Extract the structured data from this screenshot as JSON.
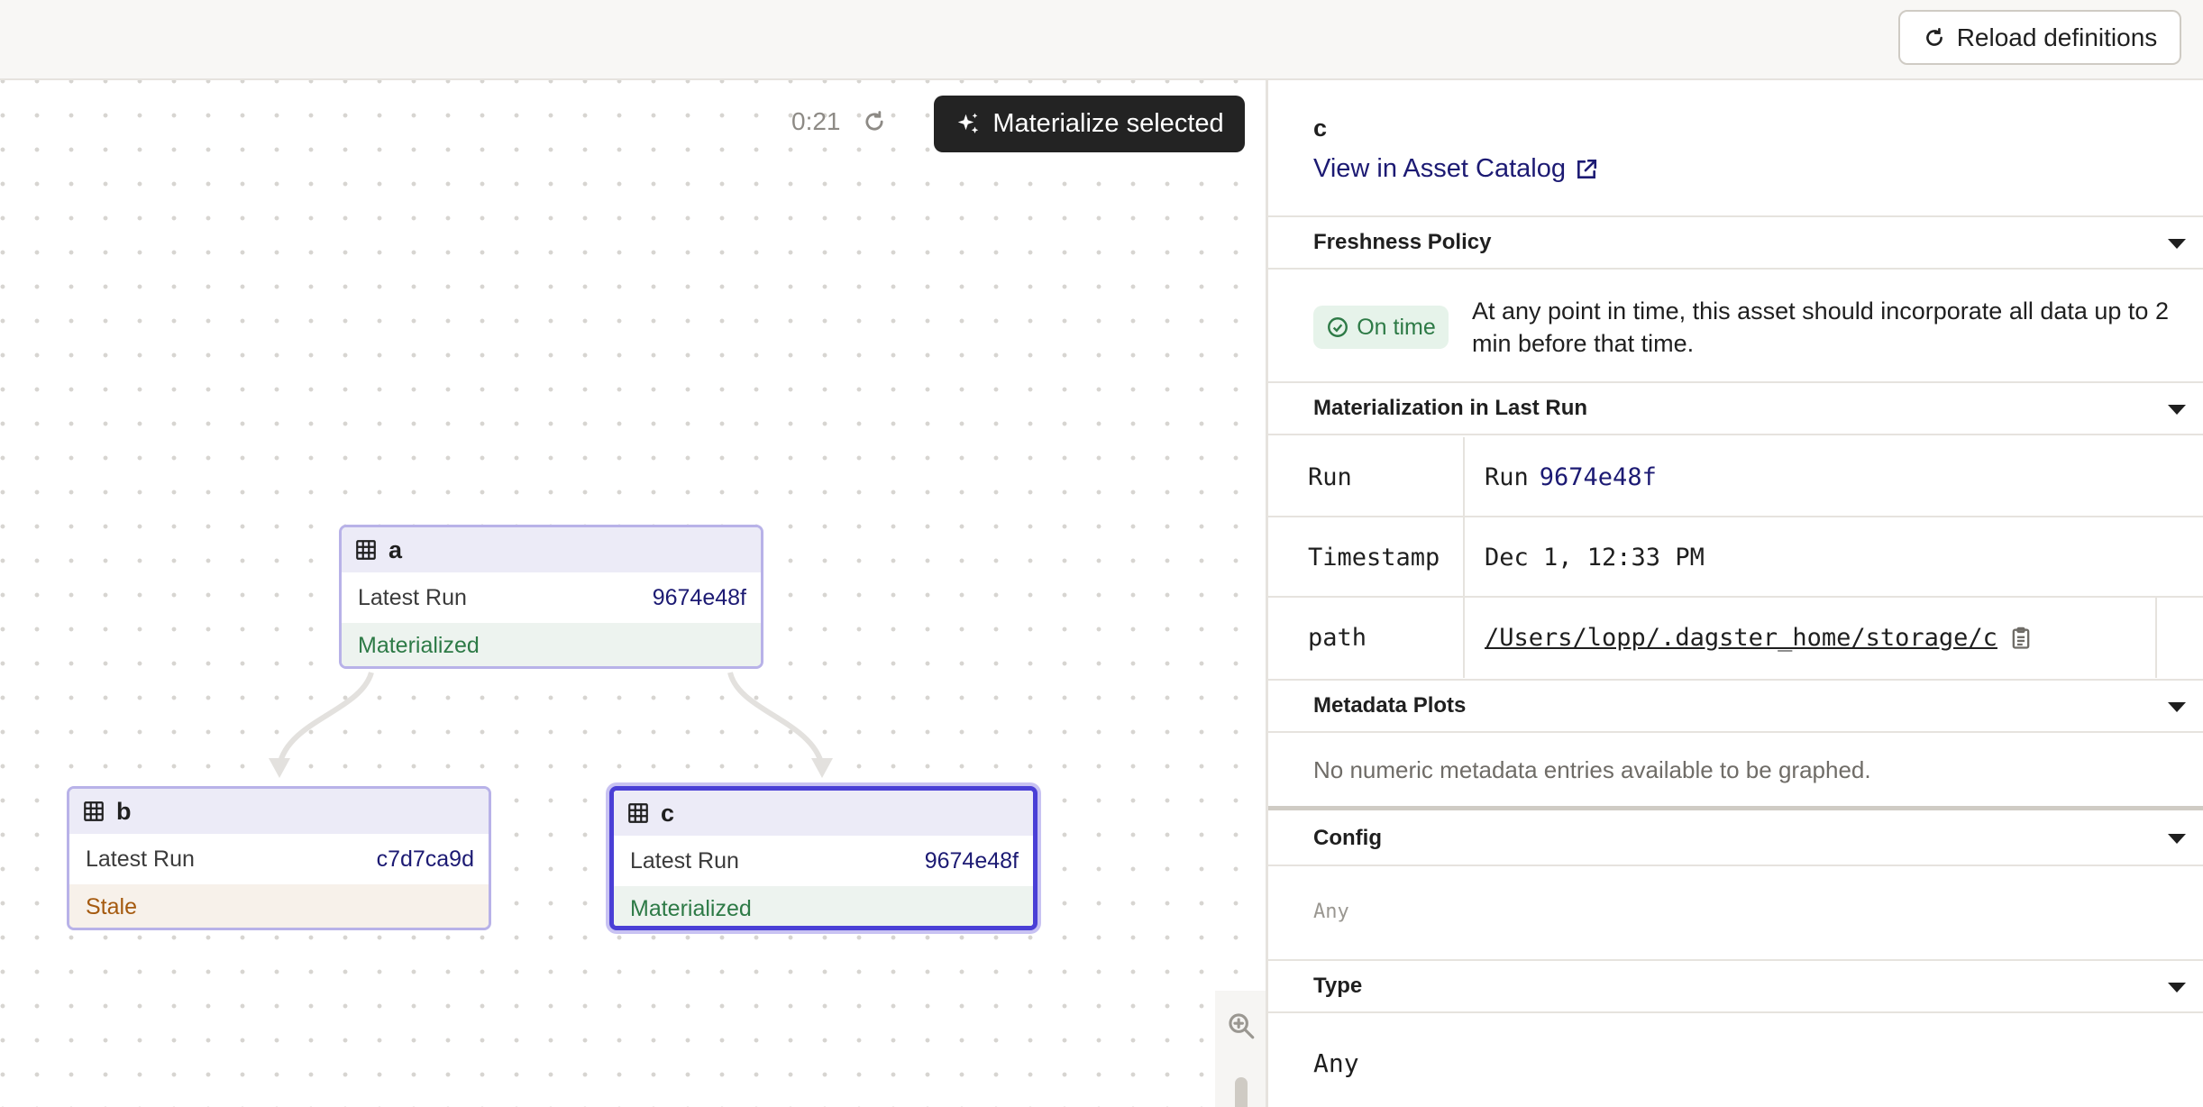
{
  "header": {
    "reload_label": "Reload definitions"
  },
  "toolbar": {
    "timer": "0:21",
    "materialize_label": "Materialize selected"
  },
  "nodes": {
    "a": {
      "name": "a",
      "latest_run_label": "Latest Run",
      "run_id": "9674e48f",
      "status": "Materialized"
    },
    "b": {
      "name": "b",
      "latest_run_label": "Latest Run",
      "run_id": "c7d7ca9d",
      "status": "Stale"
    },
    "c": {
      "name": "c",
      "latest_run_label": "Latest Run",
      "run_id": "9674e48f",
      "status": "Materialized"
    }
  },
  "panel": {
    "asset_name": "c",
    "catalog_link": "View in Asset Catalog",
    "freshness": {
      "title": "Freshness Policy",
      "badge": "On time",
      "description": "At any point in time, this asset should incorporate all data up to 2 min before that time."
    },
    "materialization": {
      "title": "Materialization in Last Run",
      "rows": [
        {
          "key": "Run",
          "prefix": "Run",
          "value": "9674e48f"
        },
        {
          "key": "Timestamp",
          "value": "Dec 1, 12:33 PM"
        },
        {
          "key": "path",
          "value": "/Users/lopp/.dagster_home/storage/c"
        }
      ]
    },
    "plots": {
      "title": "Metadata Plots",
      "empty": "No numeric metadata entries available to be graphed."
    },
    "config": {
      "title": "Config",
      "value": "Any"
    },
    "type": {
      "title": "Type",
      "value": "Any"
    }
  },
  "colors": {
    "accent": "#4a3fd6",
    "node_border": "#b8b2e8",
    "materialized": "#2d7a46",
    "stale": "#a55a0f",
    "link": "#1c1a73"
  }
}
